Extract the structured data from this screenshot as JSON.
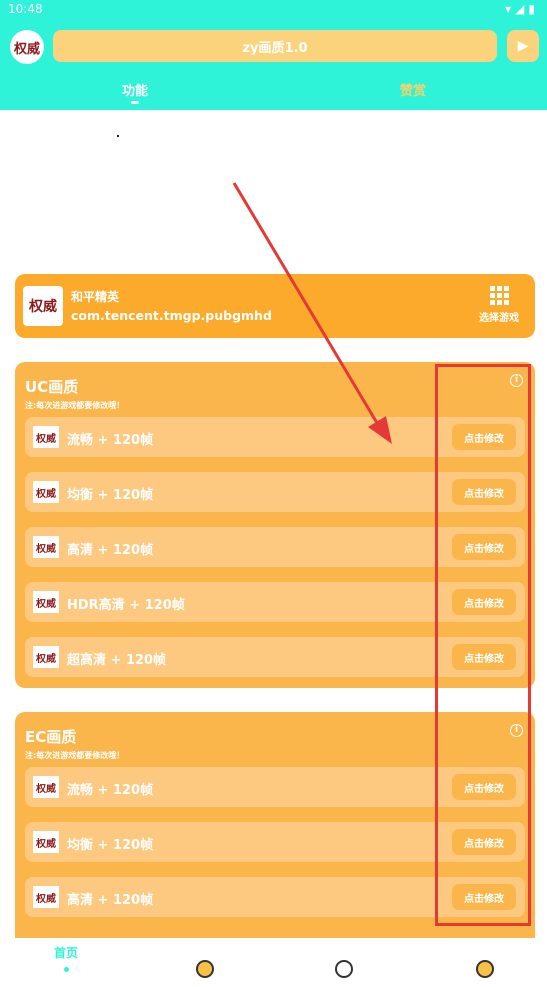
{
  "status_bar": {
    "time": "10:48"
  },
  "header": {
    "title": "zy画质1.0",
    "avatar_text": "权威",
    "tabs": [
      {
        "label": "功能",
        "active": true
      },
      {
        "label": "赞赏",
        "active": false
      }
    ]
  },
  "game": {
    "logo_text": "权威",
    "name": "和平精英",
    "package": "com.tencent.tmgp.pubgmhd",
    "select_label": "选择游戏"
  },
  "sections": [
    {
      "title": "UC画质",
      "note": "注:每次进游戏都要修改哦！",
      "rows": [
        {
          "label": "流畅 + 120帧",
          "button": "点击修改"
        },
        {
          "label": "均衡 + 120帧",
          "button": "点击修改"
        },
        {
          "label": "高清 + 120帧",
          "button": "点击修改"
        },
        {
          "label": "HDR高清 + 120帧",
          "button": "点击修改"
        },
        {
          "label": "超高清 + 120帧",
          "button": "点击修改"
        }
      ]
    },
    {
      "title": "EC画质",
      "note": "注:每次进游戏都要修改哦！",
      "rows": [
        {
          "label": "流畅 + 120帧",
          "button": "点击修改"
        },
        {
          "label": "均衡 + 120帧",
          "button": "点击修改"
        },
        {
          "label": "高清 + 120帧",
          "button": "点击修改"
        }
      ]
    }
  ],
  "bottom_nav": {
    "home_label": "首页",
    "icons": [
      "badge-check-icon",
      "pie-chart-icon",
      "user-icon"
    ]
  },
  "colors": {
    "accent_teal": "#2ff3d8",
    "card_orange": "#fbaa2b",
    "section_orange": "#fbb64b",
    "row_orange": "#fdc981",
    "highlight_red": "#e53935"
  }
}
